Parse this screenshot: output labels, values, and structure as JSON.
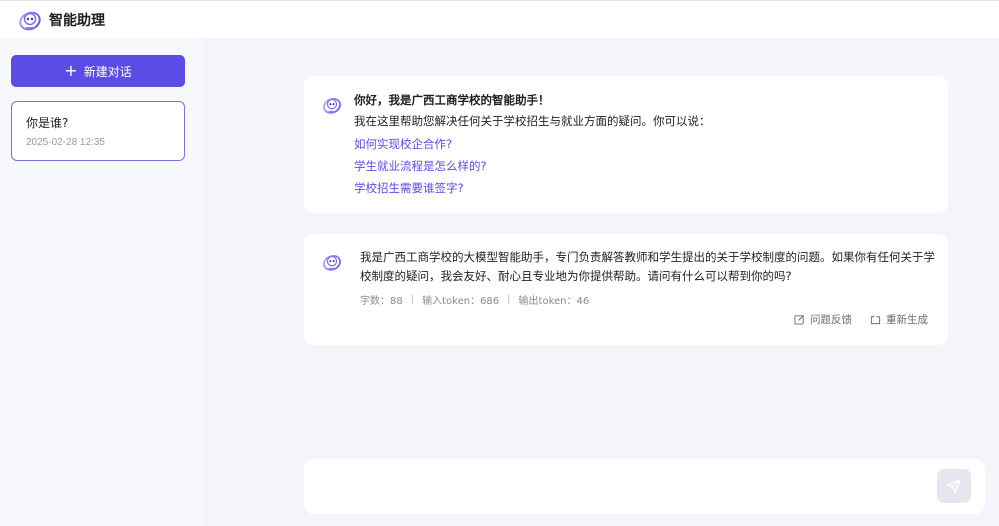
{
  "header": {
    "title": "智能助理"
  },
  "sidebar": {
    "new_chat_label": "新建对话",
    "conversations": [
      {
        "title": "你是谁?",
        "date": "2025-02-28 12:35"
      }
    ]
  },
  "welcome": {
    "greeting": "你好，我是广西工商学校的智能助手！",
    "intro": "我在这里帮助您解决任何关于学校招生与就业方面的疑问。你可以说：",
    "suggestions": [
      "如何实现校企合作?",
      "学生就业流程是怎么样的?",
      "学校招生需要谁签字?"
    ]
  },
  "reply": {
    "text": "我是广西工商学校的大模型智能助手，专门负责解答教师和学生提出的关于学校制度的问题。如果你有任何关于学校制度的疑问，我会友好、耐心且专业地为你提供帮助。请问有什么可以帮到你的吗?",
    "stats": {
      "chars": "字数：88",
      "input_tokens": "输入token：686",
      "output_tokens": "输出token：46"
    },
    "feedback_label": "问题反馈",
    "regenerate_label": "重新生成"
  },
  "composer": {
    "placeholder": ""
  },
  "colors": {
    "accent": "#5b4ce6",
    "main_bg": "#f4f5fb",
    "sidebar_bg": "#f7f8fc"
  }
}
